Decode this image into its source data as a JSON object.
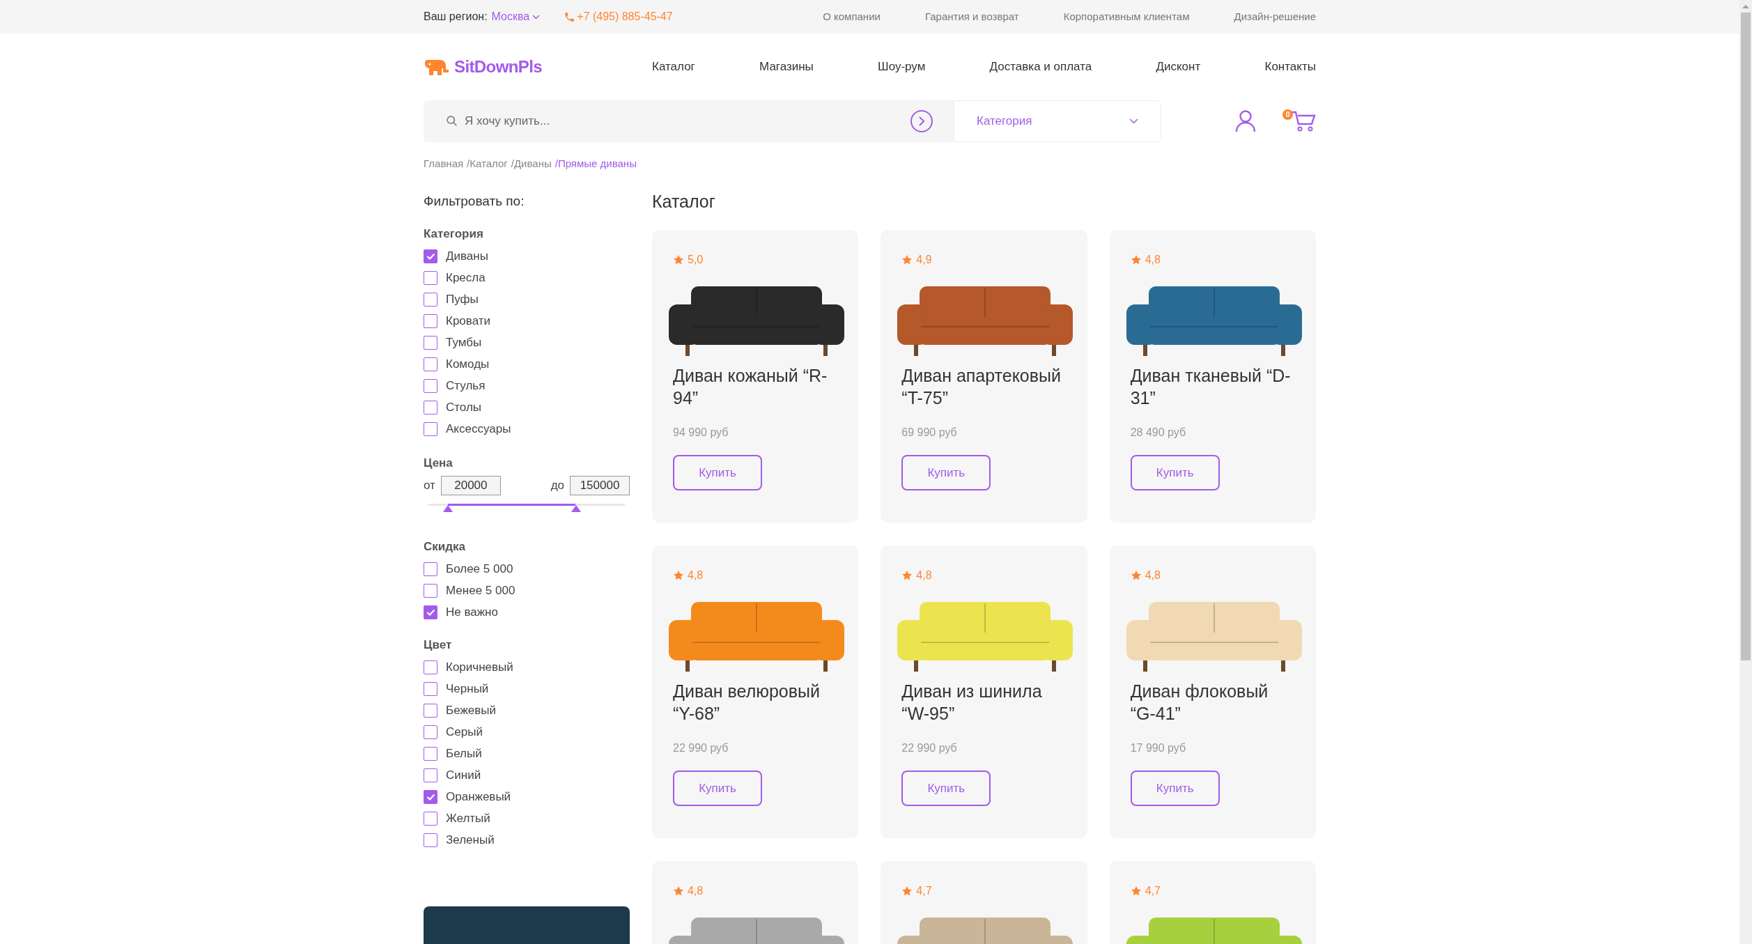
{
  "top_bar": {
    "region_label": "Ваш регион:",
    "region": "Москва",
    "phone": "+7 (495) 885-45-47",
    "links": [
      "О компании",
      "Гарантия и возврат",
      "Корпоративным клиентам",
      "Дизайн-решение"
    ]
  },
  "header": {
    "logo": "SitDownPls",
    "nav": [
      "Каталог",
      "Магазины",
      "Шоу-рум",
      "Доставка и оплата",
      "Дисконт",
      "Контакты"
    ]
  },
  "search": {
    "placeholder": "Я хочу купить...",
    "category": "Категория",
    "cart_count": "0"
  },
  "breadcrumbs": [
    {
      "label": "Главная",
      "current": false
    },
    {
      "label": "/Каталог",
      "current": false
    },
    {
      "label": "/Диваны",
      "current": false
    },
    {
      "label": "/Прямые диваны",
      "current": true
    }
  ],
  "filters": {
    "title": "Фильтровать по:",
    "category": {
      "title": "Категория",
      "options": [
        {
          "label": "Диваны",
          "checked": true
        },
        {
          "label": "Кресла",
          "checked": false
        },
        {
          "label": "Пуфы",
          "checked": false
        },
        {
          "label": "Кровати",
          "checked": false
        },
        {
          "label": "Тумбы",
          "checked": false
        },
        {
          "label": "Комоды",
          "checked": false
        },
        {
          "label": "Стулья",
          "checked": false
        },
        {
          "label": "Столы",
          "checked": false
        },
        {
          "label": "Аксессуары",
          "checked": false
        }
      ]
    },
    "price": {
      "title": "Цена",
      "from_label": "от",
      "from": "20000",
      "to_label": "до",
      "to": "150000",
      "thumbs": [
        {
          "level": 0.1
        },
        {
          "level": 0.75
        }
      ]
    },
    "discount": {
      "title": "Скидка",
      "options": [
        {
          "label": "Более 5 000",
          "checked": false
        },
        {
          "label": "Менее 5 000",
          "checked": false
        },
        {
          "label": "Не важно",
          "checked": true
        }
      ]
    },
    "color": {
      "title": "Цвет",
      "options": [
        {
          "label": "Коричневый",
          "checked": false
        },
        {
          "label": "Черный",
          "checked": false
        },
        {
          "label": "Бежевый",
          "checked": false
        },
        {
          "label": "Серый",
          "checked": false
        },
        {
          "label": "Белый",
          "checked": false
        },
        {
          "label": "Синий",
          "checked": false
        },
        {
          "label": "Оранжевый",
          "checked": true
        },
        {
          "label": "Желтый",
          "checked": false
        },
        {
          "label": "Зеленый",
          "checked": false
        }
      ]
    }
  },
  "catalog": {
    "title": "Каталог",
    "products": [
      {
        "rating": "5,0",
        "color": "#2a2a2a",
        "title": "Диван кожаный “R-94”",
        "price": "94 990 руб",
        "button": "Купить"
      },
      {
        "rating": "4,9",
        "color": "#b5582a",
        "title": "Диван апартековый “T-75”",
        "price": "69 990 руб",
        "button": "Купить"
      },
      {
        "rating": "4,8",
        "color": "#2a6b94",
        "title": "Диван тканевый “D-31”",
        "price": "28 490 руб",
        "button": "Купить"
      },
      {
        "rating": "4,8",
        "color": "#f58a1c",
        "title": "Диван велюровый “Y-68”",
        "price": "22 990 руб",
        "button": "Купить"
      },
      {
        "rating": "4,8",
        "color": "#ece44f",
        "title": "Диван из шинила “W-95”",
        "price": "22 990 руб",
        "button": "Купить"
      },
      {
        "rating": "4,8",
        "color": "#f1d9b3",
        "title": "Диван флоковый “G-41”",
        "price": "17 990 руб",
        "button": "Купить"
      },
      {
        "rating": "4,8",
        "color": "#a9a9a9"
      },
      {
        "rating": "4,7",
        "color": "#c9b597"
      },
      {
        "rating": "4,7",
        "color": "#a8cf3e"
      }
    ]
  }
}
